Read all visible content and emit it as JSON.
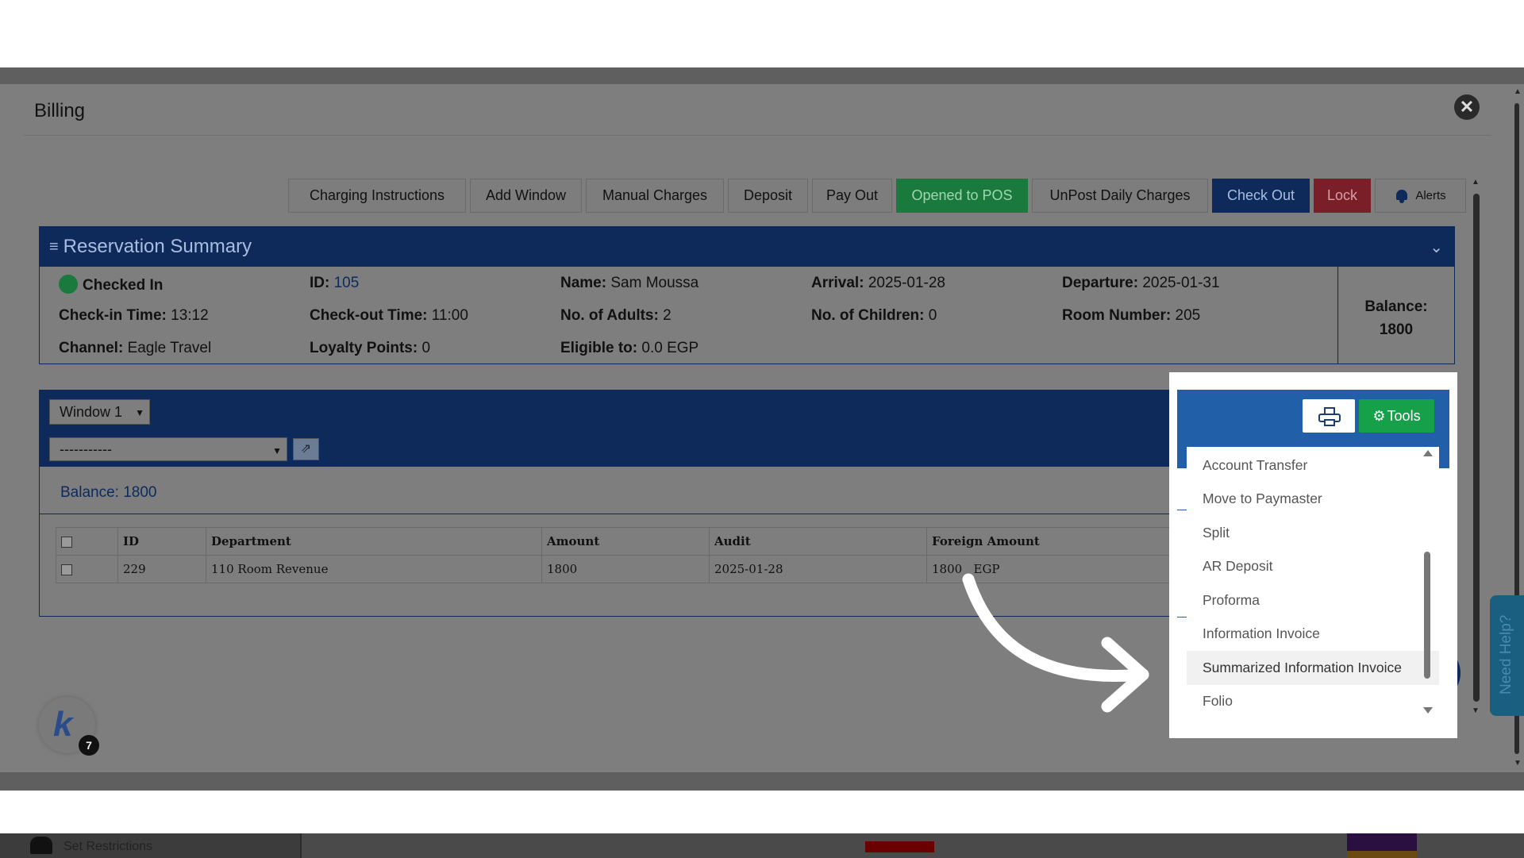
{
  "underlay": {
    "sidebar_item": "Set Restrictions"
  },
  "modal": {
    "title": "Billing",
    "close_symbol": "✕"
  },
  "toolbar": {
    "buttons": [
      "Charging Instructions",
      "Add Window",
      "Manual Charges",
      "Deposit",
      "Pay Out",
      "Opened to POS",
      "UnPost Daily Charges",
      "Check Out",
      "Lock"
    ],
    "alerts_label": "Alerts"
  },
  "summary": {
    "title": "Reservation Summary",
    "status": "Checked In",
    "id_label": "ID:",
    "id_value": "105",
    "name_label": "Name:",
    "name_value": "Sam Moussa",
    "arrival_label": "Arrival:",
    "arrival_value": "2025-01-28",
    "departure_label": "Departure:",
    "departure_value": "2025-01-31",
    "checkin_label": "Check-in Time:",
    "checkin_value": "13:12",
    "checkout_label": "Check-out Time:",
    "checkout_value": "11:00",
    "adults_label": "No. of Adults:",
    "adults_value": "2",
    "children_label": "No. of Children:",
    "children_value": "0",
    "room_label": "Room Number:",
    "room_value": "205",
    "channel_label": "Channel:",
    "channel_value": "Eagle Travel",
    "loyalty_label": "Loyalty Points:",
    "loyalty_value": "0",
    "eligible_label": "Eligible to:",
    "eligible_value": "0.0 EGP",
    "balance_label": "Balance:",
    "balance_value": "1800"
  },
  "window_panel": {
    "window_select": "Window 1",
    "secondary_select": "-----------",
    "balance_text": "Balance: 1800",
    "columns": [
      "ID",
      "Department",
      "Amount",
      "Audit",
      "Foreign Amount"
    ],
    "rows": [
      {
        "id": "229",
        "department": "110 Room Revenue",
        "amount": "1800",
        "audit": "2025-01-28",
        "foreign_amount": "1800",
        "currency": "EGP"
      }
    ]
  },
  "helper_widget": {
    "letter": "k",
    "badge": "7"
  },
  "help_tab": {
    "label": "Need Help?"
  },
  "tools_popup": {
    "tools_label": "Tools",
    "menu_items": [
      "Account Transfer",
      "Move to Paymaster",
      "Split",
      "AR Deposit",
      "Proforma",
      "Information Invoice",
      "Summarized Information Invoice",
      "Folio"
    ],
    "highlighted": "Summarized Information Invoice"
  },
  "colors": {
    "navy": "#0d2a5a",
    "green": "#1a7a3d",
    "red": "#7a1f28",
    "popup_blue": "#2160a8",
    "tools_green": "#16a049"
  }
}
